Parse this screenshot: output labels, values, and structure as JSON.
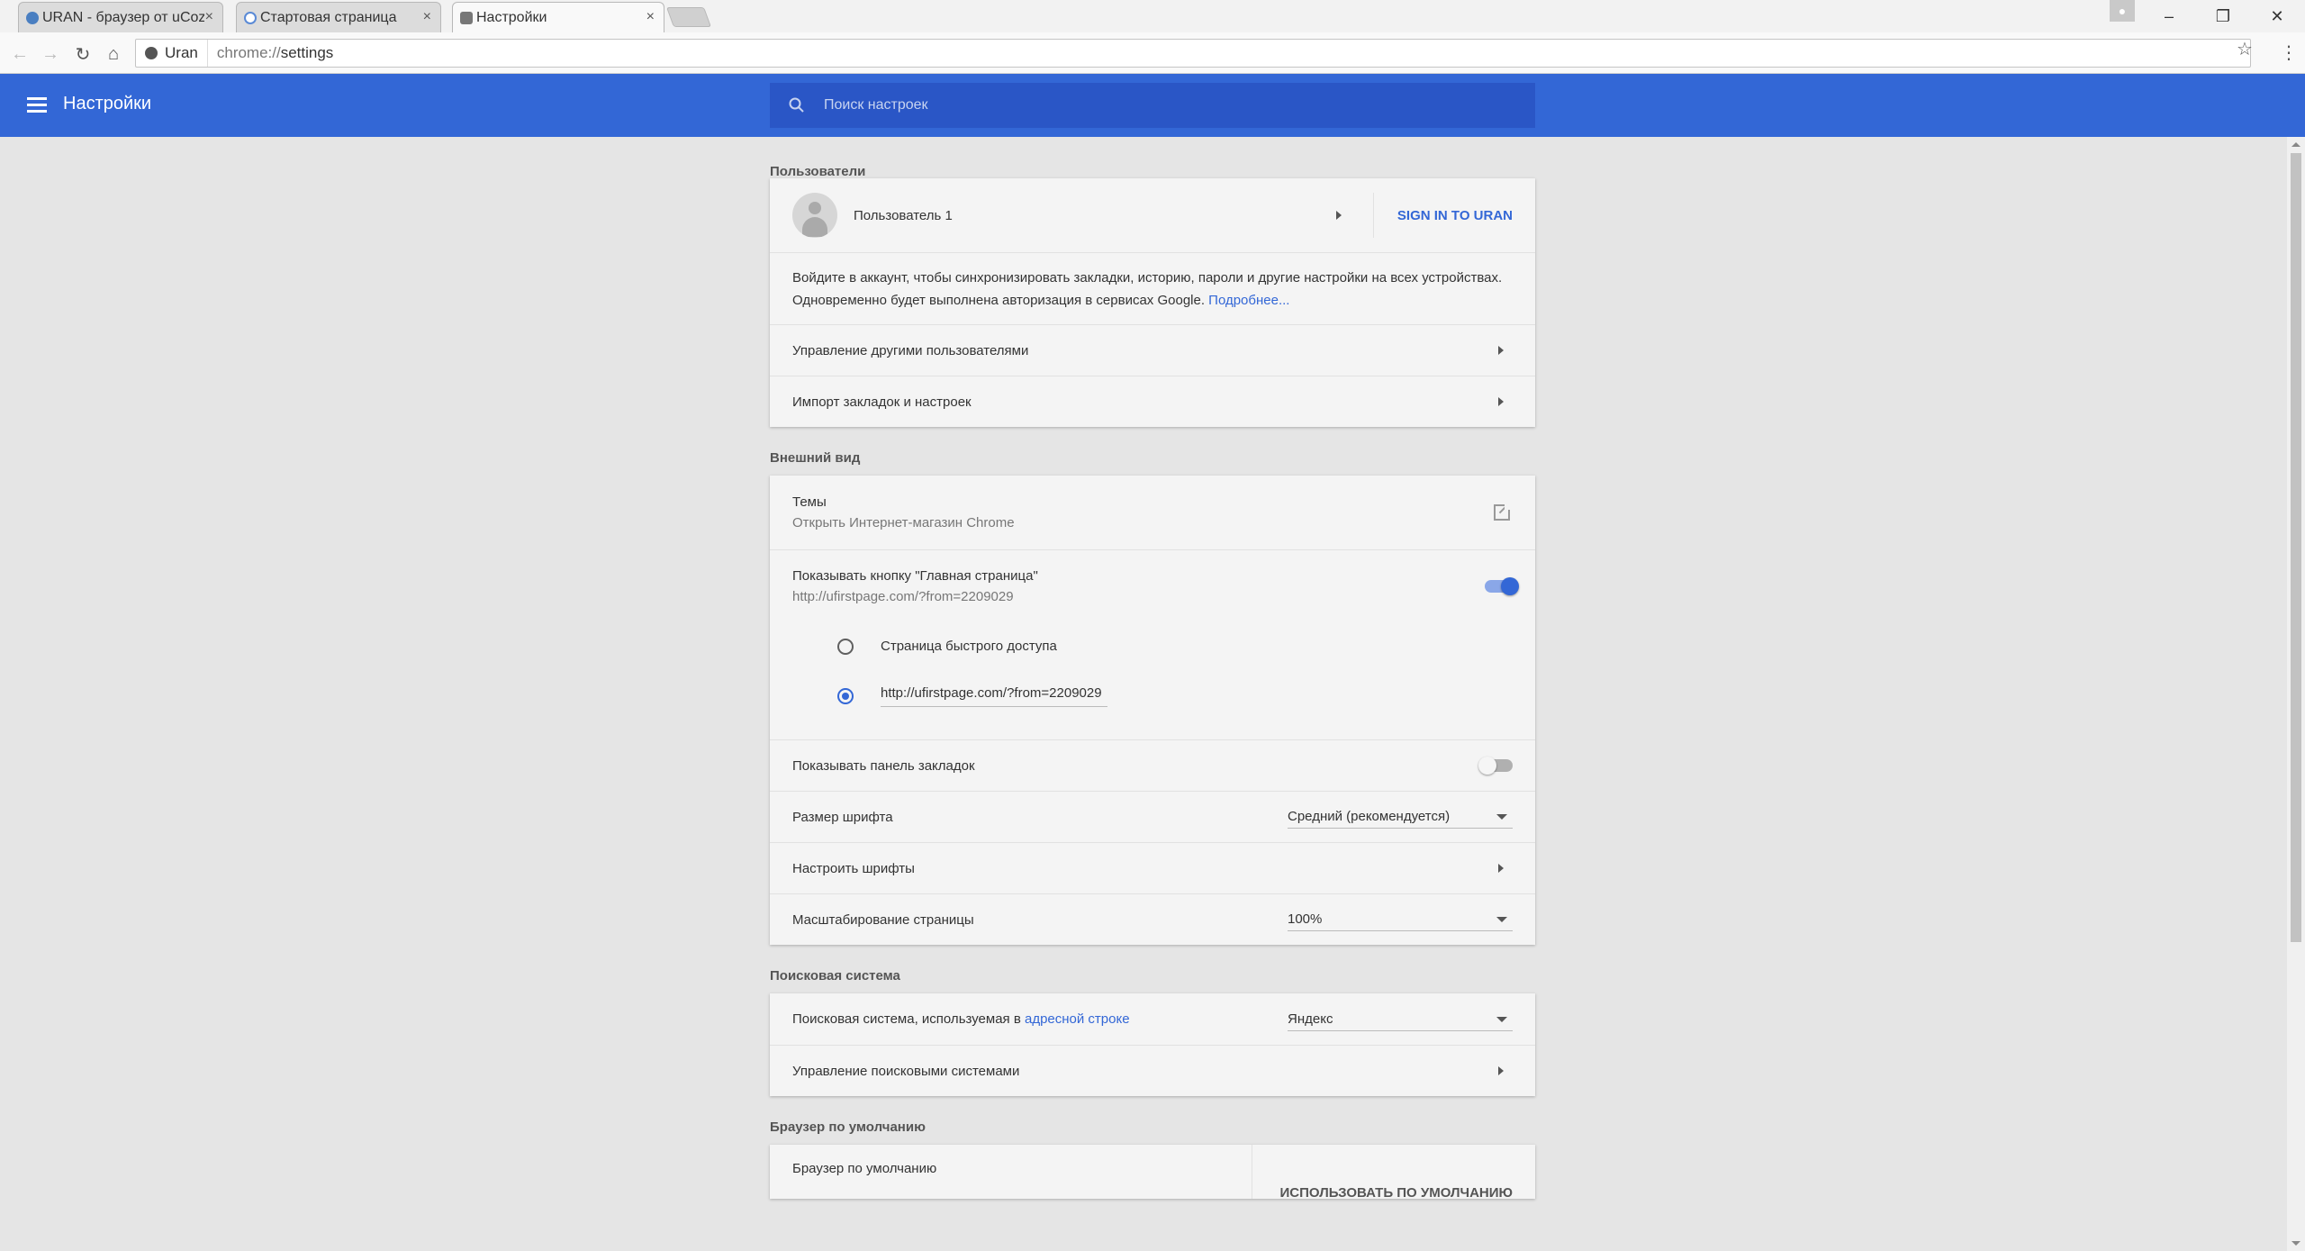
{
  "tabs": [
    {
      "title": "URAN - браузер от uCoz",
      "close": "×"
    },
    {
      "title": "Стартовая страница",
      "close": "×"
    },
    {
      "title": "Настройки",
      "close": "×"
    }
  ],
  "window_controls": {
    "minimize": "–",
    "restore": "❐",
    "close": "✕"
  },
  "toolbar": {
    "back": "←",
    "forward": "→",
    "reload": "↻",
    "home": "⌂",
    "site_label": "Uran",
    "url_scheme": "chrome://",
    "url_path": "settings",
    "star": "☆",
    "menu": "⋮"
  },
  "header": {
    "title": "Настройки",
    "search_placeholder": "Поиск настроек"
  },
  "sections": {
    "users": {
      "title": "Пользователи",
      "user_name": "Пользователь 1",
      "sign_in": "SIGN IN TO URAN",
      "sync_text": "Войдите в аккаунт, чтобы синхронизировать закладки, историю, пароли и другие настройки на всех устройствах. Одновременно будет выполнена авторизация в сервисах Google.",
      "sync_link": "Подробнее...",
      "manage_users": "Управление другими пользователями",
      "import": "Импорт закладок и настроек"
    },
    "appearance": {
      "title": "Внешний вид",
      "themes_label": "Темы",
      "themes_sub": "Открыть Интернет-магазин Chrome",
      "home_button_label": "Показывать кнопку \"Главная страница\"",
      "home_button_sub": "http://ufirstpage.com/?from=2209029",
      "home_button_enabled": true,
      "radio_ntp": "Страница быстрого доступа",
      "radio_url_value": "http://ufirstpage.com/?from=2209029",
      "bookmarks_bar_label": "Показывать панель закладок",
      "bookmarks_bar_enabled": false,
      "font_size_label": "Размер шрифта",
      "font_size_value": "Средний (рекомендуется)",
      "customize_fonts": "Настроить шрифты",
      "zoom_label": "Масштабирование страницы",
      "zoom_value": "100%"
    },
    "search": {
      "title": "Поисковая система",
      "engine_label": "Поисковая система, используемая в",
      "engine_link": "адресной строке",
      "engine_value": "Яндекс",
      "manage_engines": "Управление поисковыми системами"
    },
    "default_browser": {
      "title": "Браузер по умолчанию",
      "label": "Браузер по умолчанию",
      "button": "ИСПОЛЬЗОВАТЬ ПО УМОЛЧАНИЮ"
    }
  },
  "colors": {
    "accent": "#3367d6",
    "header_bg": "#3367d6",
    "search_bg": "#2a56c6"
  }
}
